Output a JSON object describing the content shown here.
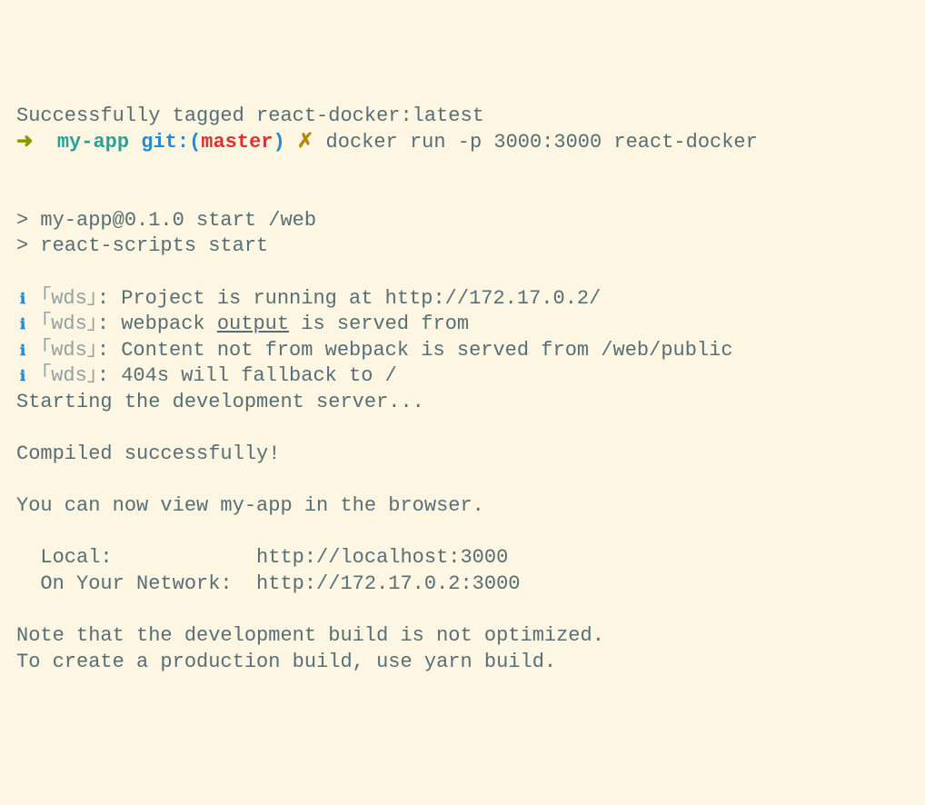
{
  "lines": {
    "tagged": "Successfully tagged react-docker:latest",
    "prompt": {
      "arrow": "➜",
      "dir": "my-app",
      "git": "git:",
      "open": "(",
      "branch": "master",
      "close": ")",
      "dirty": "✗",
      "command": "docker run -p 3000:3000 react-docker"
    },
    "npm1": "> my-app@0.1.0 start /web",
    "npm2": "> react-scripts start",
    "wds_tag": "｢wds｣",
    "wds1": ": Project is running at http://172.17.0.2/",
    "wds2a": ": webpack ",
    "wds2b": "output",
    "wds2c": " is served from ",
    "wds3": ": Content not from webpack is served from /web/public",
    "wds4": ": 404s will fallback to /",
    "starting": "Starting the development server...",
    "compiled": "Compiled successfully!",
    "view": "You can now view my-app in the browser.",
    "local": "  Local:            http://localhost:3000",
    "network": "  On Your Network:  http://172.17.0.2:3000",
    "note1": "Note that the development build is not optimized.",
    "note2": "To create a production build, use yarn build."
  }
}
